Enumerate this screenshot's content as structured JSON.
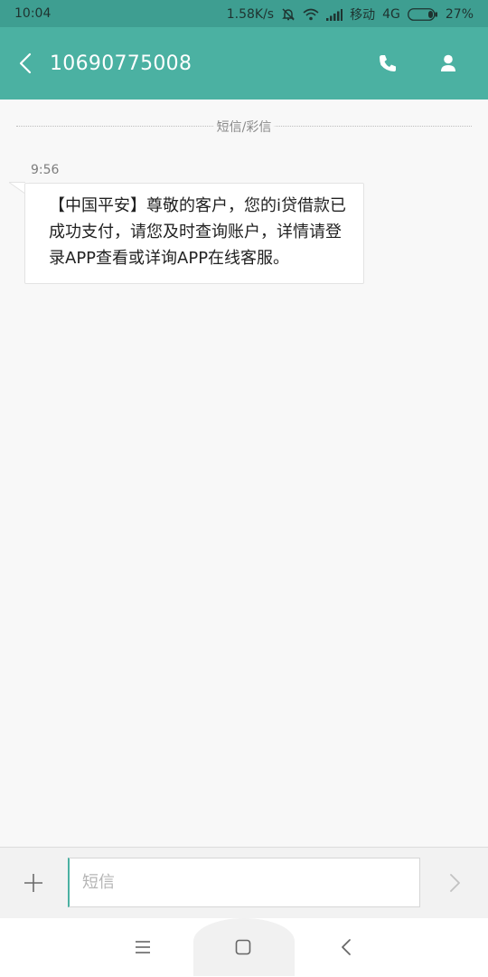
{
  "status_bar": {
    "time": "10:04",
    "network_speed": "1.58K/s",
    "carrier": "移动",
    "network_type": "4G",
    "battery": "27%",
    "battery_level": 0.27,
    "icons": [
      "mute-icon",
      "wifi-icon",
      "signal-icon",
      "battery-icon"
    ]
  },
  "header": {
    "title": "10690775008",
    "icons": [
      "back-icon",
      "phone-icon",
      "contact-icon"
    ]
  },
  "conversation": {
    "channel_label": "短信/彩信",
    "messages": [
      {
        "time": "9:56",
        "text": "【中国平安】尊敬的客户，您的i贷借款已成功支付，请您及时查询账户，详情请登录APP查看或详询APP在线客服。"
      }
    ]
  },
  "composer": {
    "placeholder": "短信",
    "value": "",
    "icons": [
      "plus-icon",
      "send-icon"
    ]
  },
  "nav_bar": {
    "icons": [
      "menu-icon",
      "home-icon",
      "back-icon"
    ]
  },
  "colors": {
    "status_bar": "#3e9e91",
    "app_bar": "#4bb1a2",
    "background": "#f8f8f8",
    "bubble": "#ffffff"
  }
}
